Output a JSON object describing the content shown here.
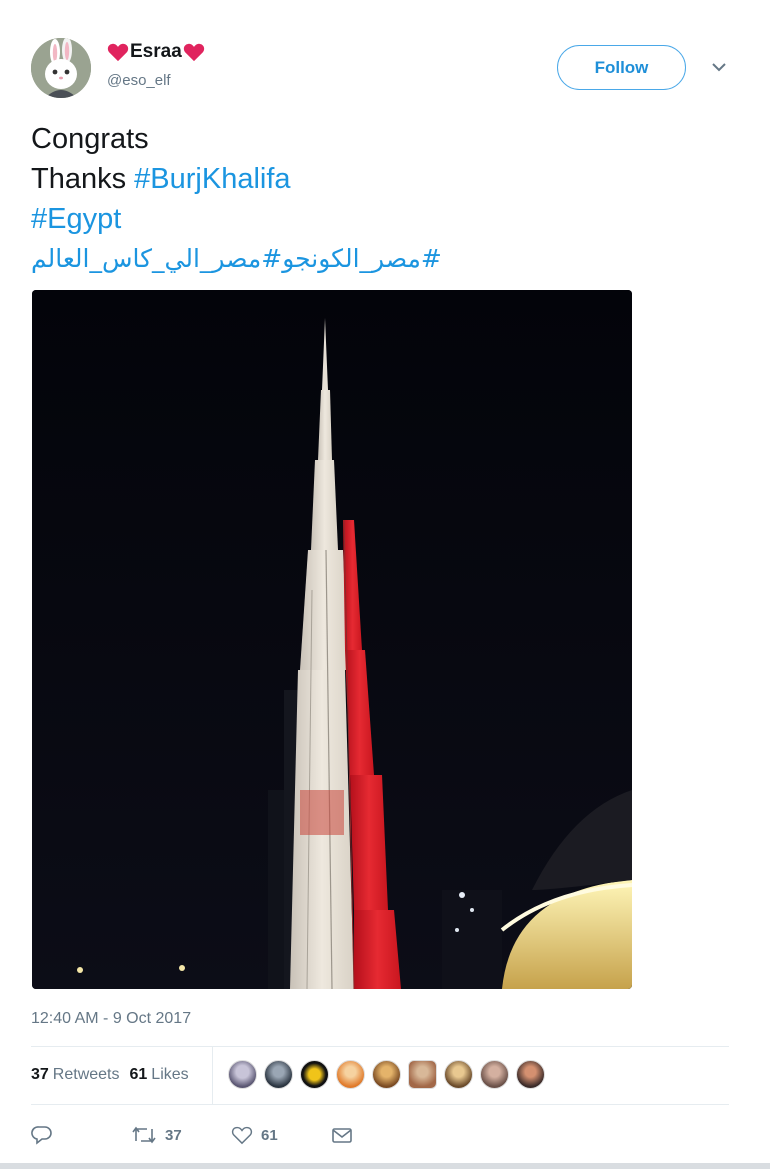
{
  "user": {
    "display_name": "Esraa",
    "handle": "@eso_elf"
  },
  "header": {
    "follow_label": "Follow"
  },
  "tweet": {
    "line1": "Congrats",
    "line2_text": "Thanks ",
    "line2_hashtag": "#BurjKhalifa",
    "line3_hashtag": "#Egypt",
    "line4_arabic": "#مصر_الكونجو#مصر_الي_كاس_العالم"
  },
  "meta": {
    "timestamp": "12:40 AM - 9 Oct 2017"
  },
  "stats": {
    "retweets_count": "37",
    "retweets_label": "Retweets",
    "likes_count": "61",
    "likes_label": "Likes"
  },
  "actions": {
    "retweet_count": "37",
    "like_count": "61"
  },
  "colors": {
    "link": "#1b95e0",
    "heart": "#e0245e",
    "muted": "#657786",
    "egypt_red": "#e0202a"
  },
  "icons": [
    "heart-emoji-icon",
    "chevron-down-icon",
    "reply-icon",
    "retweet-icon",
    "like-icon",
    "direct-message-icon"
  ]
}
